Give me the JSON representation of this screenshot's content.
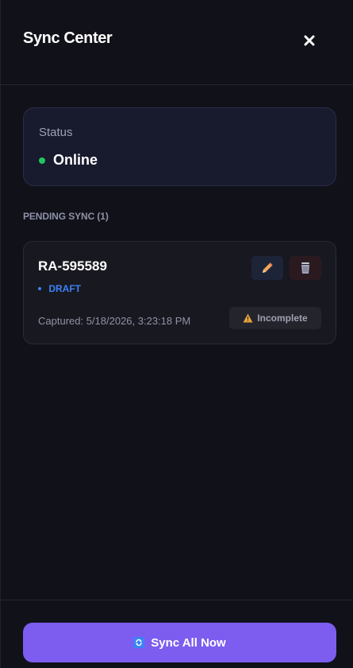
{
  "header": {
    "title": "Sync Center",
    "close_icon": "close-icon"
  },
  "status_card": {
    "label": "Status",
    "value": "Online",
    "indicator_color": "#22c55e"
  },
  "pending": {
    "heading": "PENDING SYNC (1)",
    "items": [
      {
        "id": "RA-595589",
        "type": "DRAFT",
        "captured": "Captured: 5/18/2026, 3:23:18 PM",
        "badge": "Incomplete",
        "badge_icon": "warning-icon",
        "edit_icon": "pencil-icon",
        "delete_icon": "trash-icon"
      }
    ]
  },
  "footer": {
    "sync_label": "Sync All Now",
    "sync_icon": "refresh-icon"
  },
  "colors": {
    "accent": "#7c5df0",
    "draft": "#3b82f6",
    "online": "#22c55e"
  }
}
